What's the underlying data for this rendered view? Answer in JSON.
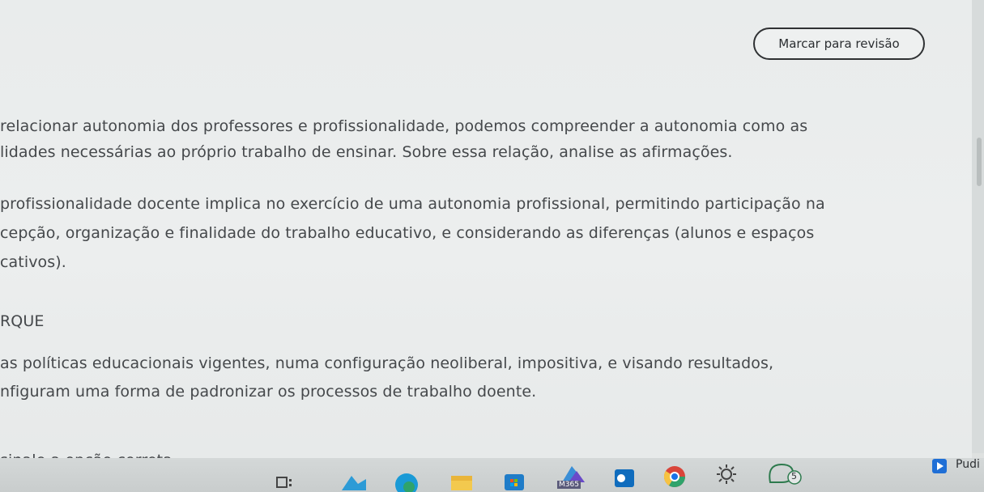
{
  "mark_button": {
    "label": "Marcar para revisão"
  },
  "question": {
    "intro_1": "relacionar autonomia dos professores e profissionalidade, podemos compreender a autonomia como as",
    "intro_2": "lidades necessárias ao próprio trabalho de ensinar. Sobre essa relação, analise as afirmações.",
    "assertion_1_l1": "profissionalidade docente implica no exercício de uma autonomia profissional, permitindo participação na",
    "assertion_1_l2": "cepção, organização e finalidade do trabalho educativo, e considerando as diferenças (alunos e espaços",
    "assertion_1_l3": "cativos).",
    "connector": "RQUE",
    "assertion_2_l1": "as políticas educacionais vigentes, numa configuração neoliberal, impositiva, e visando resultados,",
    "assertion_2_l2": "nfiguram uma forma de padronizar os processos de trabalho doente.",
    "prompt": "sinale a opção correta."
  },
  "taskbar": {
    "m365_label": "M365",
    "badge_count": "5",
    "app_label": "Pudi",
    "colors": {
      "edge": "#1a9ad6",
      "chrome_red": "#d9453a",
      "outlook": "#0f6cbd",
      "accent_green": "#2fa36b"
    }
  }
}
